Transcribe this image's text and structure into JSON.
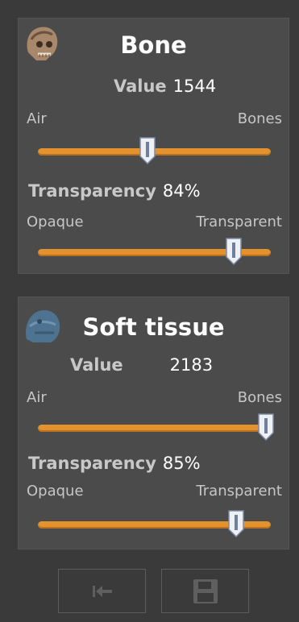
{
  "panels": [
    {
      "title": "Bone",
      "value_label": "Value",
      "value": "1544",
      "range_left": "Air",
      "range_right": "Bones",
      "value_slider_fraction": 0.47,
      "transparency_label": "Transparency",
      "transparency": "84%",
      "opacity_left": "Opaque",
      "opacity_right": "Transparent",
      "transparency_slider_fraction": 0.84,
      "icon": "skull-bone-icon"
    },
    {
      "title": "Soft tissue",
      "value_label": "Value",
      "value": "2183",
      "range_left": "Air",
      "range_right": "Bones",
      "value_slider_fraction": 1.0,
      "transparency_label": "Transparency",
      "transparency": "85%",
      "opacity_left": "Opaque",
      "opacity_right": "Transparent",
      "transparency_slider_fraction": 0.85,
      "icon": "soft-tissue-head-icon"
    }
  ],
  "footer": {
    "reset_icon": "reset-to-start-icon",
    "save_icon": "save-icon"
  },
  "colors": {
    "background": "#3a3a3a",
    "panel": "#4b4b4b",
    "slider_track": "#e4922e",
    "text_light": "#ffffff",
    "text_label": "#c8c8c8"
  }
}
